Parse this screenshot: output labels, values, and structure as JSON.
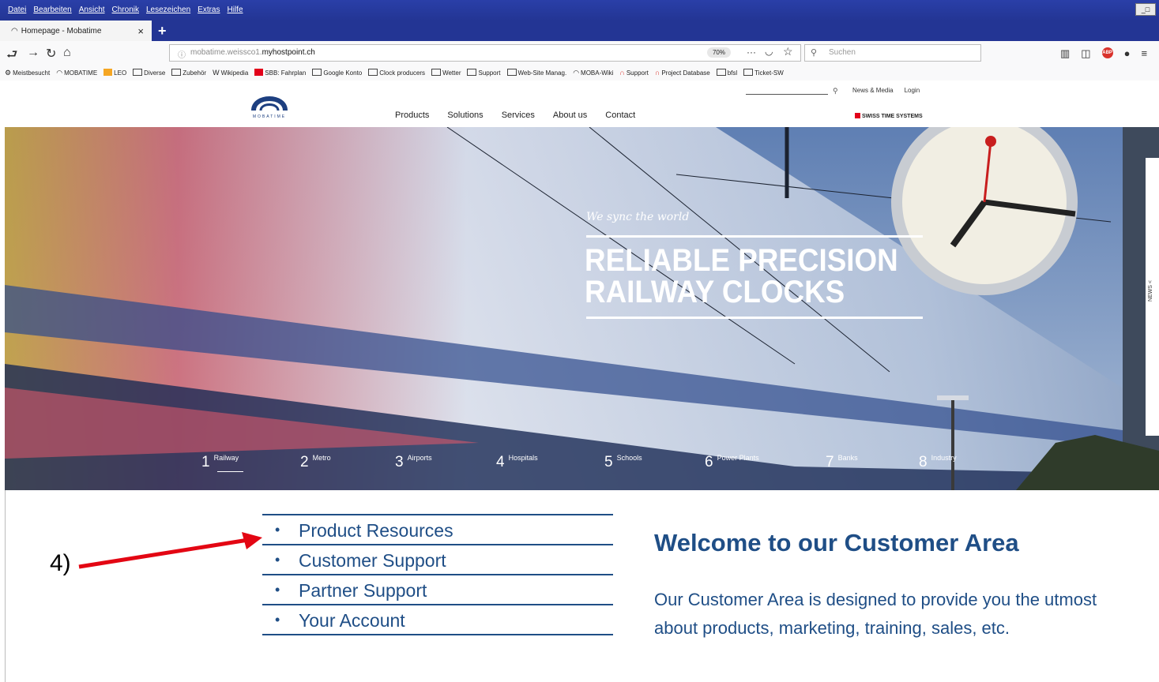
{
  "browser": {
    "menu": [
      "Datei",
      "Bearbeiten",
      "Ansicht",
      "Chronik",
      "Lesezeichen",
      "Extras",
      "Hilfe"
    ],
    "tab_title": "Homepage - Mobatime",
    "tab_close": "×",
    "new_tab": "+",
    "url_prefix": "mobatime.weissco1.",
    "url_domain": "myhostpoint.ch",
    "zoom": "70%",
    "search_placeholder": "Suchen",
    "bookmarks": [
      {
        "label": "Meistbesucht",
        "icon": "gear-icon"
      },
      {
        "label": "MOBATIME",
        "icon": "moba-icon"
      },
      {
        "label": "LEO",
        "icon": "leo-icon"
      },
      {
        "label": "Diverse",
        "icon": "folder-icon"
      },
      {
        "label": "Zubehör",
        "icon": "folder-icon"
      },
      {
        "label": "Wikipedia",
        "icon": "wikipedia-icon"
      },
      {
        "label": "SBB: Fahrplan",
        "icon": "sbb-icon"
      },
      {
        "label": "Google Konto",
        "icon": "folder-icon"
      },
      {
        "label": "Clock producers",
        "icon": "folder-icon"
      },
      {
        "label": "Wetter",
        "icon": "folder-icon"
      },
      {
        "label": "Support",
        "icon": "folder-icon"
      },
      {
        "label": "Web-Site Manag.",
        "icon": "folder-icon"
      },
      {
        "label": "MOBA-Wiki",
        "icon": "moba-icon"
      },
      {
        "label": "Support",
        "icon": "support-icon"
      },
      {
        "label": "Project Database",
        "icon": "support-icon"
      },
      {
        "label": "bfsl",
        "icon": "folder-icon"
      },
      {
        "label": "Ticket-SW",
        "icon": "folder-icon"
      }
    ]
  },
  "site": {
    "logo_text": "MOBATIME",
    "nav": [
      "Products",
      "Solutions",
      "Services",
      "About us",
      "Contact"
    ],
    "top_links": [
      "News & Media",
      "Login"
    ],
    "swiss_badge": "SWISS TIME SYSTEMS",
    "hero": {
      "tagline": "We sync the world",
      "headline_line1": "RELIABLE PRECISION",
      "headline_line2": "RAILWAY CLOCKS",
      "news_tab": "NEWS <",
      "slides": [
        {
          "n": "1",
          "label": "Railway"
        },
        {
          "n": "2",
          "label": "Metro"
        },
        {
          "n": "3",
          "label": "Airports"
        },
        {
          "n": "4",
          "label": "Hospitals"
        },
        {
          "n": "5",
          "label": "Schools"
        },
        {
          "n": "6",
          "label": "Power Plants"
        },
        {
          "n": "7",
          "label": "Banks"
        },
        {
          "n": "8",
          "label": "Industry"
        }
      ]
    },
    "customer_menu": [
      "Product Resources",
      "Customer Support",
      "Partner Support",
      "Your Account"
    ],
    "welcome_title": "Welcome to our Customer Area",
    "intro_line1": "Our Customer Area is designed to provide you the utmost",
    "intro_line2": "about products, marketing, training, sales, etc."
  },
  "annotation": {
    "label": "4)",
    "color": "#e30613"
  },
  "colors": {
    "brand_blue": "#1f4e86",
    "window_blue": "#233594"
  }
}
